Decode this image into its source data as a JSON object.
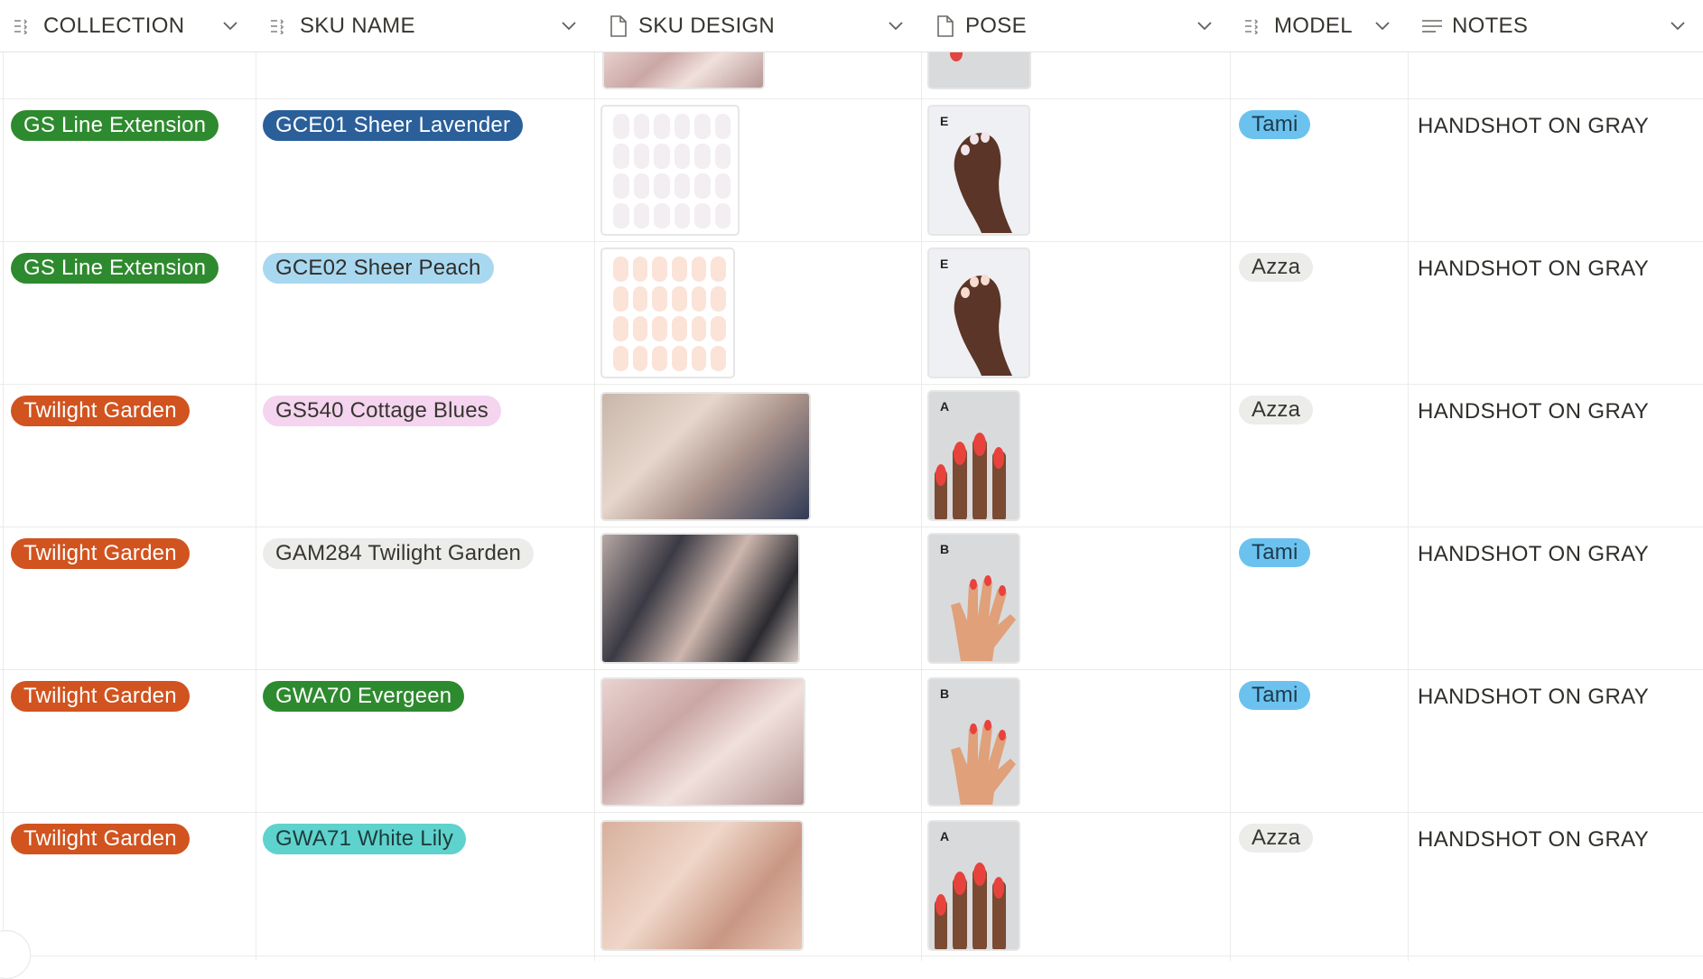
{
  "columns": [
    {
      "label": "COLLECTION",
      "icon": "multi-select-icon"
    },
    {
      "label": "SKU NAME",
      "icon": "multi-select-icon"
    },
    {
      "label": "SKU DESIGN",
      "icon": "file-icon"
    },
    {
      "label": "POSE",
      "icon": "file-icon"
    },
    {
      "label": "MODEL",
      "icon": "multi-select-icon"
    },
    {
      "label": "NOTES",
      "icon": "text-icon"
    }
  ],
  "rows": [
    {
      "collection": "GS Line Extension",
      "sku": "GCE01 Sheer Lavender",
      "design": "sheet",
      "pose": "E",
      "model": "Tami",
      "notes": "HANDSHOT ON GRAY"
    },
    {
      "collection": "GS Line Extension",
      "sku": "GCE02 Sheer Peach",
      "design": "sheet",
      "pose": "E",
      "model": "Azza",
      "notes": "HANDSHOT ON GRAY"
    },
    {
      "collection": "Twilight Garden",
      "sku": "GS540 Cottage Blues",
      "design": "photo",
      "pose": "A",
      "model": "Azza",
      "notes": "HANDSHOT ON GRAY"
    },
    {
      "collection": "Twilight Garden",
      "sku": "GAM284 Twilight Garden",
      "design": "photo",
      "pose": "B",
      "model": "Tami",
      "notes": "HANDSHOT ON GRAY"
    },
    {
      "collection": "Twilight Garden",
      "sku": "GWA70 Evergeen",
      "design": "photo",
      "pose": "B",
      "model": "Tami",
      "notes": "HANDSHOT ON GRAY"
    },
    {
      "collection": "Twilight Garden",
      "sku": "GWA71 White Lily",
      "design": "photo",
      "pose": "A",
      "model": "Azza",
      "notes": "HANDSHOT ON GRAY"
    }
  ],
  "colors": {
    "collection_green": "#2e8a2e",
    "collection_orange": "#d1531f",
    "sku_blue_dark": "#2a5f9a",
    "sku_light_blue": "#a8d8f0",
    "sku_pink": "#f4d4ef",
    "sku_gray": "#ececeb",
    "sku_green": "#2e8a2e",
    "sku_teal": "#5ed2cd",
    "model_blue": "#6cc2ee",
    "model_gray": "#ececeb"
  }
}
